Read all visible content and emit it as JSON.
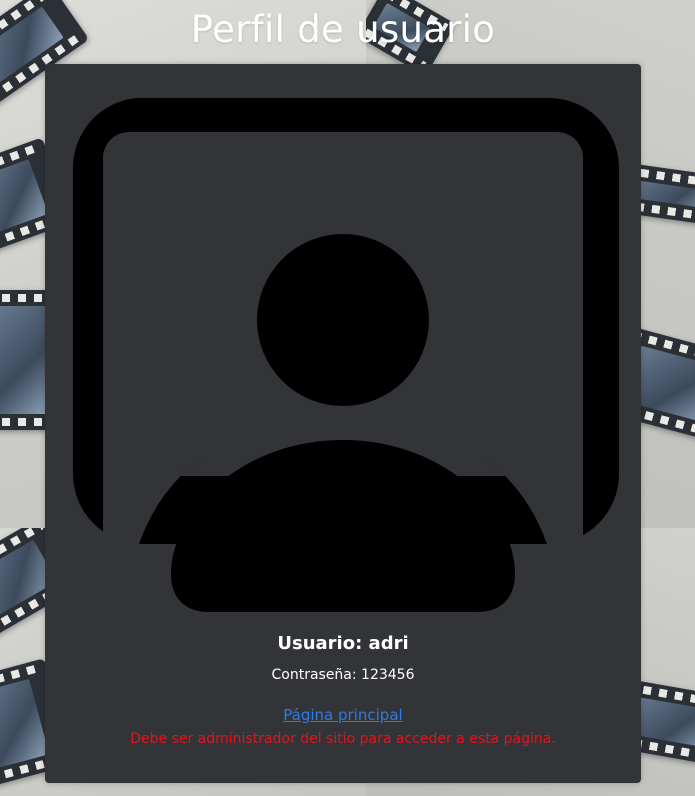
{
  "page": {
    "title": "Perfil de usuario"
  },
  "profile": {
    "avatar_icon": "account-box-icon",
    "username_line": "Usuario: adri",
    "password_line": "Contraseña: 123456"
  },
  "links": {
    "home_label": "Página principal"
  },
  "messages": {
    "admin_required": "Debe ser administrador del sitio para acceder a esta página."
  },
  "colors": {
    "card_background": "#323438",
    "link": "#2f7ae8",
    "error": "#e0141c",
    "title_text": "#ffffff"
  }
}
